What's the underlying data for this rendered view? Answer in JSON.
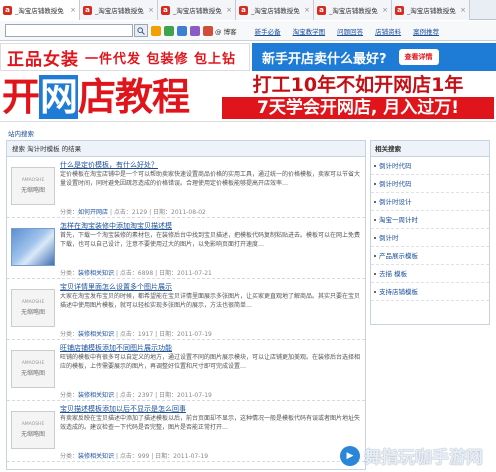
{
  "tabs": [
    {
      "label": "_淘宝店铺教授免",
      "active": true
    },
    {
      "label": "_淘宝店铺教授免",
      "active": false
    },
    {
      "label": "_淘宝店铺教授免",
      "active": false
    },
    {
      "label": "_淘宝店铺教授免",
      "active": false
    },
    {
      "label": "_淘宝店铺教授免",
      "active": false
    },
    {
      "label": "_淘宝店铺教授免",
      "active": false
    }
  ],
  "toolbar": {
    "blog_label": "@ 博客",
    "links": [
      "新手必备",
      "淘宝教学图",
      "问题回答",
      "店铺资料",
      "案例推荐"
    ]
  },
  "banner_top": {
    "left_main": "正品女装",
    "left_sub": "一件代发 包装修 包上钻",
    "right_text": "新手开店卖什么最好?",
    "right_button": "查看详情"
  },
  "banner_main": {
    "title_a": "开",
    "title_b": "网",
    "title_c": "店教程",
    "line1": "打工10年不如开网店1年",
    "line2": "7天学会开网店, 月入过万!"
  },
  "breadcrumb": "站内搜索",
  "results": {
    "header": "搜索 淘计时模板 的结果",
    "thumb_small": "AMAOSHE",
    "thumb_text": "无缩略图",
    "items": [
      {
        "title": "什么是定价模板，有什么好处？",
        "body": "定价模板在淘宝店铺中是一个可以帮助卖家快速设置商品价格的实用工具，通过统一的价格模板，卖家可以节省大量设置时间，同时避免因疏忽造成的价格错误。合理使用定价模板能够提高开店效率…",
        "cat": "如何开网店",
        "views": "点击：2129",
        "date": "日期：2011-08-02",
        "photo": false
      },
      {
        "title": "怎样在淘宝装修中添加淘宝贝描述模",
        "body": "首先，下载一个淘宝装修的素材包，在装修后台中找到宝贝描述，把模板代码复制粘贴进去。模板可以在网上免费下载，也可以自己设计，注意不要使用过大的图片，以免影响页面打开速度…",
        "cat": "装修相关知识",
        "views": "点击：6898",
        "date": "日期：2011-07-21",
        "photo": true
      },
      {
        "title": "宝贝详情里面怎么设置多个图片展示",
        "body": "大家在淘宝发布宝贝的时候，都希望能在宝贝详情里面展示多张图片，让买家更直观地了解商品。其实只要在宝贝描述中使用图片模板，就可以轻松实现多张图片的展示，方法也很简单…",
        "cat": "装修相关知识",
        "views": "点击：1917",
        "date": "日期：2011-07-19",
        "photo": false
      },
      {
        "title": "旺铺店铺模板添加不同图片展示功能",
        "body": "旺铺的模板中有很多可以自定义的地方，通过设置不同的图片展示模块，可以让店铺更加美观。在装修后台选择相应的模板，上传需要展示的图片，再调整好位置和尺寸即可完成设置…",
        "cat": "装修相关知识",
        "views": "点击：2397",
        "date": "日期：2011-07-19",
        "photo": false
      },
      {
        "title": "宝贝描述模板添加以后不显示是怎么回事",
        "body": "有卖家反映在宝贝描述中添加了描述模板以后，前台页面却不显示，这种情况一般是模板代码有误或者图片地址失效造成的。建议检查一下代码是否完整，图片是否能正常打开…",
        "cat": "装修相关知识",
        "views": "点击：999",
        "date": "日期：2011-07-19",
        "photo": false
      }
    ]
  },
  "sidebar": {
    "title": "相关搜索",
    "items": [
      "倒计时代码",
      "倒计时代码",
      "倒计时设计",
      "淘宝一周计时",
      "倒计时",
      "产品展示模板",
      "去描 模板",
      "支持店铺模板"
    ]
  },
  "watermark": "舞指玩咖手游网"
}
